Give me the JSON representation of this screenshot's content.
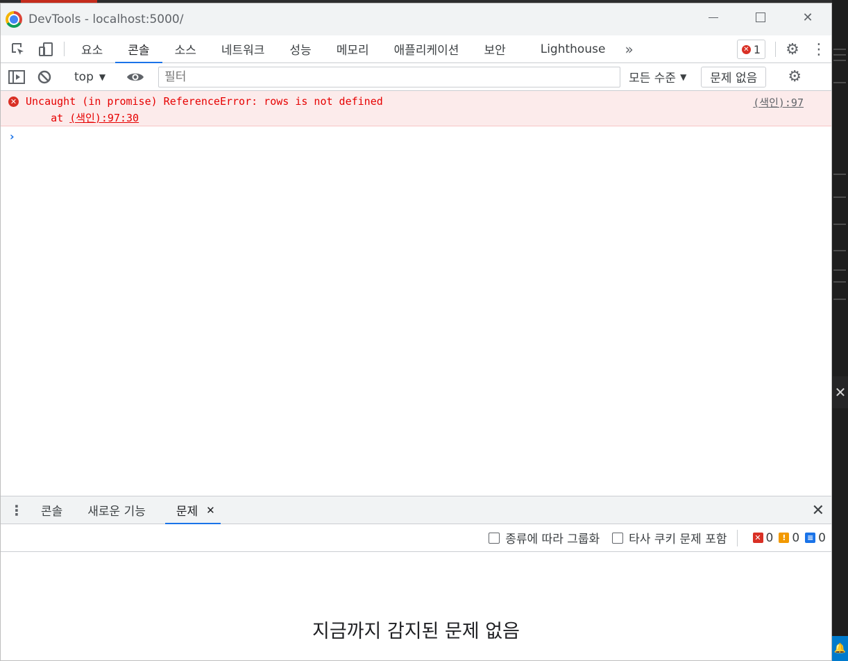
{
  "window": {
    "title": "DevTools - localhost:5000/"
  },
  "main_tabs": [
    {
      "label": "요소"
    },
    {
      "label": "콘솔"
    },
    {
      "label": "소스"
    },
    {
      "label": "네트워크"
    },
    {
      "label": "성능"
    },
    {
      "label": "메모리"
    },
    {
      "label": "애플리케이션"
    },
    {
      "label": "보안"
    },
    {
      "label": "Lighthouse"
    }
  ],
  "error_badge": {
    "count": "1"
  },
  "console_toolbar": {
    "context": "top",
    "filter_placeholder": "필터",
    "levels": "모든 수준",
    "issues_button": "문제 없음"
  },
  "console_messages": [
    {
      "level": "error",
      "message": "Uncaught (in promise) ReferenceError: rows is not defined",
      "stack_prefix": "    at ",
      "stack_link": "(색인):97:30",
      "source": "(색인):97"
    }
  ],
  "drawer": {
    "tabs": [
      {
        "label": "콘솔"
      },
      {
        "label": "새로운 기능"
      },
      {
        "label": "문제"
      }
    ],
    "group_by_kind": "종류에 따라 그룹화",
    "include_third_party": "타사 쿠키 문제 포함",
    "counts": {
      "errors": "0",
      "warnings": "0",
      "info": "0"
    },
    "empty_message": "지금까지 감지된 문제 없음"
  },
  "colors": {
    "accent": "#1a73e8",
    "error": "#d93025",
    "error_bg": "#fcebeb",
    "warning": "#f29900"
  }
}
